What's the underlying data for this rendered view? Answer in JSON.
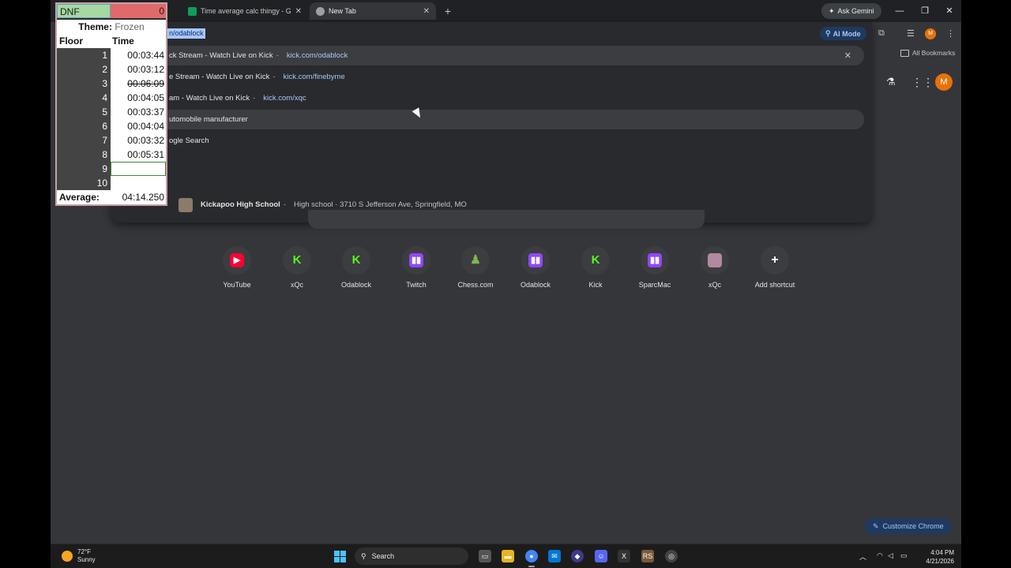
{
  "tabs": [
    {
      "title": "Time average calc thingy - Goo",
      "active": false
    },
    {
      "title": "New Tab",
      "active": true
    }
  ],
  "header": {
    "gemini_label": "Ask Gemini",
    "ai_mode_label": "AI Mode",
    "avatar_letter": "M"
  },
  "omnibox": {
    "selected_text": "n/odablock"
  },
  "suggestions": [
    {
      "title": "ck Stream - Watch Live on Kick",
      "url": "kick.com/odablock"
    },
    {
      "title": "e Stream - Watch Live on Kick",
      "url": "kick.com/finebyme"
    },
    {
      "title": "am - Watch Live on Kick",
      "url": "kick.com/xqc"
    },
    {
      "title": "utomobile manufacturer"
    },
    {
      "title": "ogle Search"
    },
    {
      "title": "Kickapoo High School",
      "desc": "High school · 3710 S Jefferson Ave, Springfield, MO"
    }
  ],
  "bookmarks_label": "All Bookmarks",
  "shortcuts": [
    {
      "label": "YouTube",
      "icon": "youtube-icon",
      "color": "#ff0033"
    },
    {
      "label": "xQc",
      "icon": "kick-icon",
      "color": "#53fc18"
    },
    {
      "label": "Odablock",
      "icon": "kick-icon",
      "color": "#53fc18"
    },
    {
      "label": "Twitch",
      "icon": "twitch-icon",
      "color": "#9146ff"
    },
    {
      "label": "Chess.com",
      "icon": "chess-pawn-icon",
      "color": "#81b64c"
    },
    {
      "label": "Odablock",
      "icon": "twitch-icon",
      "color": "#9146ff"
    },
    {
      "label": "Kick",
      "icon": "kick-icon",
      "color": "#53fc18"
    },
    {
      "label": "SparcMac",
      "icon": "twitch-icon",
      "color": "#9146ff"
    },
    {
      "label": "xQc",
      "icon": "xqc-avatar-icon",
      "color": "#b08aa0"
    },
    {
      "label": "Add shortcut",
      "icon": "plus-icon",
      "color": "#e8eaed"
    }
  ],
  "customize_label": "Customize Chrome",
  "timer": {
    "dnf_label": "DNF",
    "dnf_count": "0",
    "theme_label": "Theme:",
    "theme_value": "Frozen",
    "col_floor": "Floor",
    "col_time": "Time",
    "rows": [
      {
        "floor": "1",
        "time": "00:03:44",
        "strike": false
      },
      {
        "floor": "2",
        "time": "00:03:12",
        "strike": false
      },
      {
        "floor": "3",
        "time": "00:06:09",
        "strike": true
      },
      {
        "floor": "4",
        "time": "00:04:05",
        "strike": false
      },
      {
        "floor": "5",
        "time": "00:03:37",
        "strike": false
      },
      {
        "floor": "6",
        "time": "00:04:04",
        "strike": false
      },
      {
        "floor": "7",
        "time": "00:03:32",
        "strike": false
      },
      {
        "floor": "8",
        "time": "00:05:31",
        "strike": false
      },
      {
        "floor": "9",
        "time": "",
        "strike": false
      },
      {
        "floor": "10",
        "time": "",
        "strike": false
      }
    ],
    "average_label": "Average:",
    "average_value": "04:14.250"
  },
  "taskbar": {
    "temp": "72°F",
    "condition": "Sunny",
    "search_label": "Search",
    "time": "4:04 PM",
    "date": "4/21/2026"
  }
}
